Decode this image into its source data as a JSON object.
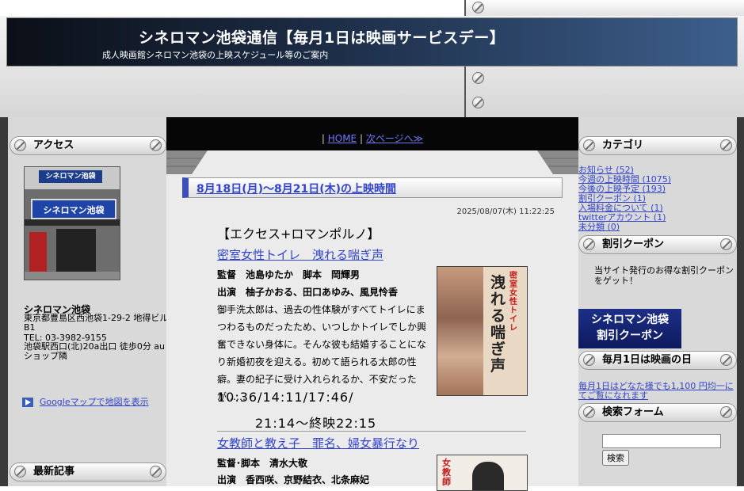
{
  "header": {
    "title": "シネロマン池袋通信【毎月1日は映画サービスデー】",
    "description": "成人映画館シネロマン池袋の上映スケジュール等のご案内"
  },
  "left_sidebar": {
    "access": {
      "heading": "アクセス",
      "photo_sign_top": "シネロマン池袋",
      "photo_sign_main": "シネロマン池袋",
      "name": "シネロマン池袋",
      "address": "東京都豊島区西池袋1-29-2 地得ビルB1",
      "tel": "TEL: 03-3982-9155",
      "directions": "池袋駅西口(北)20a出口 徒歩0分 auショップ隣",
      "map_link": "Googleマップで地図を表示"
    },
    "recent_posts_heading": "最新記事"
  },
  "nav": {
    "separator": "|",
    "home": "HOME",
    "next": "次ページへ≫"
  },
  "post": {
    "title": "8月18日(月)～8月21日(木)の上映時間",
    "date": "2025/08/07(木) 11:22:25",
    "section": "【エクセス+ロマンポルノ】",
    "film1": {
      "title": "密室女性トイレ　洩れる喘ぎ声",
      "credits": "監督　池島ゆたか　脚本　岡輝男",
      "cast": "出演　柚子かおる、田口あゆみ、風見怜香",
      "synopsis": "御手洗太郎は、過去の性体験がすべてトイレにまつわるものだったため、いつしかトイレでしか興奮できない身体に。そんな彼も結婚することになり新婚初夜を迎える。初めて語られる太郎の性癖。妻の紀子に受け入れられるか、不安だったが……",
      "times": "10:36/14:11/17:46/",
      "times2": "21:14～終映22:15",
      "poster_text": "洩れる喘ぎ声",
      "poster_sub": "密室女性トイレ"
    },
    "film2": {
      "title": "女教師と教え子　罪名、婦女暴行なり",
      "credits": "監督･脚本　清水大敬",
      "cast": "出演　香西咲、京野結衣、北条麻妃",
      "poster_text": "女教師"
    }
  },
  "right_sidebar": {
    "categories_heading": "カテゴリ",
    "categories": [
      "お知らせ (52)",
      "今週の上映時間 (1075)",
      "今後の上映予定 (193)",
      "割引クーポン (1)",
      "入場料金について (1)",
      "twitterアカウント (1)",
      "未分類 (0)"
    ],
    "coupon_heading": "割引クーポン",
    "coupon_text": "当サイト発行のお得な割引クーポンをゲット！",
    "coupon_banner_line1": "シネロマン池袋",
    "coupon_banner_line2": "割引クーポン",
    "movie_day_heading": "毎月1日は映画の日",
    "movie_day_text": "毎月1日はどなた様でも1,100 円均一にてご覧になれます",
    "search_heading": "検索フォーム",
    "search_button": "検索",
    "search_value": ""
  }
}
